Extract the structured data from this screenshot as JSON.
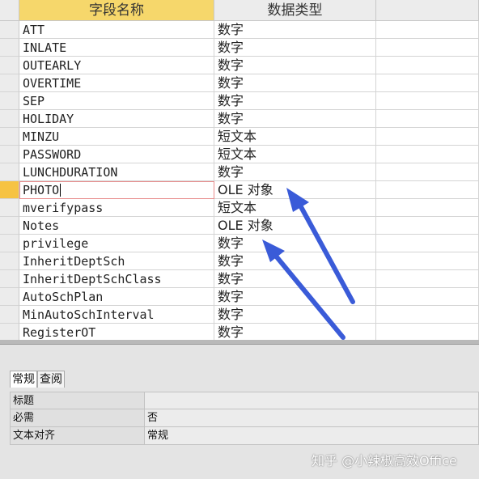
{
  "table": {
    "columns": [
      "字段名称",
      "数据类型",
      ""
    ],
    "rows": [
      {
        "name": "ATT",
        "type": "数字"
      },
      {
        "name": "INLATE",
        "type": "数字"
      },
      {
        "name": "OUTEARLY",
        "type": "数字"
      },
      {
        "name": "OVERTIME",
        "type": "数字"
      },
      {
        "name": "SEP",
        "type": "数字"
      },
      {
        "name": "HOLIDAY",
        "type": "数字"
      },
      {
        "name": "MINZU",
        "type": "短文本"
      },
      {
        "name": "PASSWORD",
        "type": "短文本"
      },
      {
        "name": "LUNCHDURATION",
        "type": "数字"
      },
      {
        "name": "PHOTO",
        "type": "OLE 对象"
      },
      {
        "name": "mverifypass",
        "type": "短文本"
      },
      {
        "name": "Notes",
        "type": "OLE 对象"
      },
      {
        "name": "privilege",
        "type": "数字"
      },
      {
        "name": "InheritDeptSch",
        "type": "数字"
      },
      {
        "name": "InheritDeptSchClass",
        "type": "数字"
      },
      {
        "name": "AutoSchPlan",
        "type": "数字"
      },
      {
        "name": "MinAutoSchInterval",
        "type": "数字"
      },
      {
        "name": "RegisterOT",
        "type": "数字"
      }
    ]
  },
  "properties": {
    "tabs": [
      "常规",
      "查阅"
    ],
    "rows": [
      {
        "label": "标题",
        "value": ""
      },
      {
        "label": "必需",
        "value": "否"
      },
      {
        "label": "文本对齐",
        "value": "常规"
      }
    ]
  },
  "watermark": "知乎 @小辣椒高效Office",
  "colors": {
    "header_active": "#f6d76b",
    "arrow": "#3a5bd8",
    "row_selector_active": "#f6c343"
  }
}
